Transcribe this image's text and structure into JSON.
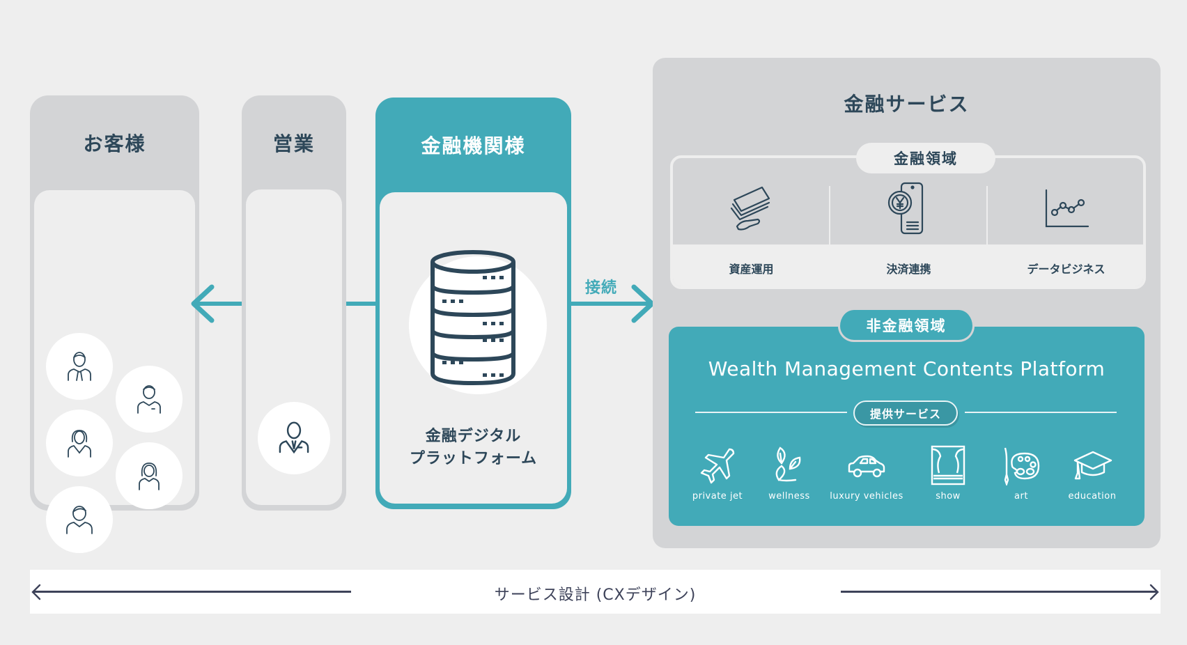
{
  "colors": {
    "teal": "#42aab8",
    "navy": "#2d4759",
    "card_gray": "#d3d4d6",
    "background": "#eeeeee"
  },
  "customers": {
    "title": "お客様",
    "avatars": [
      "man-tie-icon",
      "man-shirt-icon",
      "woman-suit-icon",
      "woman-icon",
      "man-casual-icon"
    ]
  },
  "sales": {
    "title": "営業",
    "avatar": "businessman-icon"
  },
  "institution": {
    "title": "金融機関様",
    "platform_line1": "金融デジタル",
    "platform_line2": "プラットフォーム",
    "icon": "database-server-icon"
  },
  "connection": {
    "label": "接続"
  },
  "services": {
    "title": "金融サービス",
    "financial": {
      "label": "金融領域",
      "items": [
        {
          "label": "資産運用",
          "icon": "money-hand-icon"
        },
        {
          "label": "決済連携",
          "icon": "yen-phone-icon"
        },
        {
          "label": "データビジネス",
          "icon": "line-chart-icon"
        }
      ]
    },
    "non_financial": {
      "label": "非金融領域",
      "title": "Wealth Management Contents Platform",
      "offer_label": "提供サービス",
      "items": [
        {
          "label": "private jet",
          "icon": "airplane-icon"
        },
        {
          "label": "wellness",
          "icon": "leaves-icon"
        },
        {
          "label": "luxury vehicles",
          "icon": "car-icon"
        },
        {
          "label": "show",
          "icon": "theater-curtain-icon"
        },
        {
          "label": "art",
          "icon": "palette-icon"
        },
        {
          "label": "education",
          "icon": "graduation-cap-icon"
        }
      ]
    }
  },
  "cx": {
    "label": "サービス設計 (CXデザイン)"
  }
}
